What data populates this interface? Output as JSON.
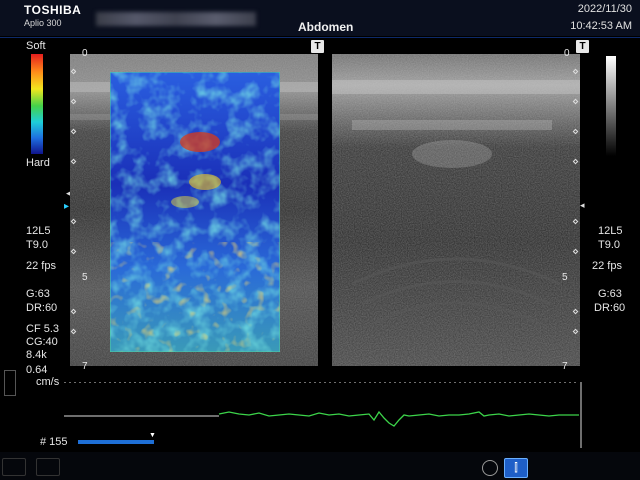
{
  "header": {
    "brand": "TOSHIBA",
    "model": "Aplio 300",
    "preset": "Abdomen",
    "date": "2022/11/30",
    "time": "10:42:53 AM"
  },
  "scale": {
    "soft_label": "Soft",
    "hard_label": "Hard"
  },
  "left_params": {
    "probe": "12L5",
    "tissue": "T9.0",
    "fps": "22 fps",
    "gain": "G:63",
    "dr": "DR:60",
    "cf": "CF 5.3",
    "cg": "CG:40",
    "freq": "8.4k",
    "vel": "0.64",
    "vel_unit": "cm/s"
  },
  "right_params": {
    "probe": "12L5",
    "tissue": "T9.0",
    "fps": "22 fps",
    "gain": "G:63",
    "dr": "DR:60"
  },
  "depth_labels": {
    "top": "0",
    "mid": "5",
    "bottom": "7"
  },
  "buttons": {
    "t_label": "T"
  },
  "trace": {
    "frame_label": "# 155",
    "color": "#3cd44a"
  },
  "colors": {
    "top_bar": "#0a0f1e",
    "frame_slider": "#1e6fd6",
    "bottom_active": "#1e5fc8"
  }
}
